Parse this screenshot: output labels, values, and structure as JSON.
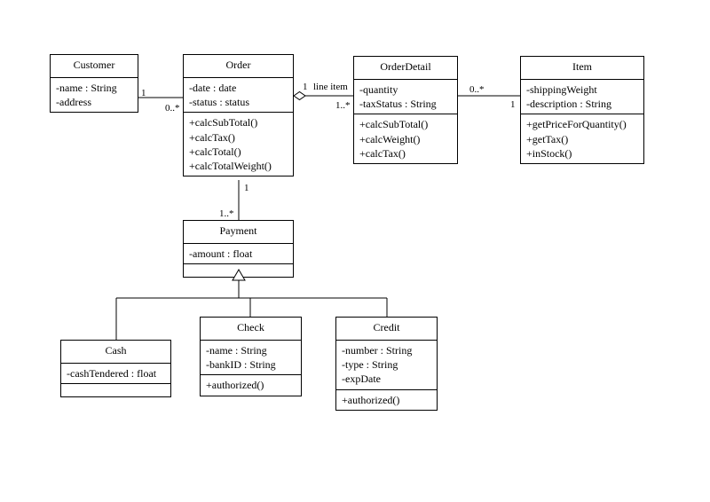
{
  "diagram": {
    "type": "UML Class Diagram",
    "classes": {
      "customer": {
        "name": "Customer",
        "attributes": [
          "-name : String",
          "-address"
        ],
        "operations": []
      },
      "order": {
        "name": "Order",
        "attributes": [
          "-date : date",
          "-status : status"
        ],
        "operations": [
          "+calcSubTotal()",
          "+calcTax()",
          "+calcTotal()",
          "+calcTotalWeight()"
        ]
      },
      "orderDetail": {
        "name": "OrderDetail",
        "attributes": [
          "-quantity",
          "-taxStatus : String"
        ],
        "operations": [
          "+calcSubTotal()",
          "+calcWeight()",
          "+calcTax()"
        ]
      },
      "item": {
        "name": "Item",
        "attributes": [
          "-shippingWeight",
          "-description : String"
        ],
        "operations": [
          "+getPriceForQuantity()",
          "+getTax()",
          "+inStock()"
        ]
      },
      "payment": {
        "name": "Payment",
        "attributes": [
          "-amount : float"
        ],
        "operations": []
      },
      "cash": {
        "name": "Cash",
        "attributes": [
          "-cashTendered : float"
        ],
        "operations": []
      },
      "check": {
        "name": "Check",
        "attributes": [
          "-name : String",
          "-bankID : String"
        ],
        "operations": [
          "+authorized()"
        ]
      },
      "credit": {
        "name": "Credit",
        "attributes": [
          "-number : String",
          "-type : String",
          "-expDate"
        ],
        "operations": [
          "+authorized()"
        ]
      }
    },
    "associations": {
      "customer_order": {
        "endA": "1",
        "endB": "0..*",
        "label": ""
      },
      "order_orderDetail": {
        "endA": "1",
        "endB": "1..*",
        "label": "line item",
        "aggregation": "diamond-on-order"
      },
      "orderDetail_item": {
        "endA": "0..*",
        "endB": "1"
      },
      "order_payment": {
        "endA": "1",
        "endB": "1..*"
      }
    },
    "generalizations": [
      "Cash → Payment",
      "Check → Payment",
      "Credit → Payment"
    ]
  },
  "chart_data": {
    "type": "table",
    "title": "UML Class Diagram — Order System",
    "classes": [
      {
        "name": "Customer",
        "attributes": [
          "-name : String",
          "-address"
        ],
        "operations": []
      },
      {
        "name": "Order",
        "attributes": [
          "-date : date",
          "-status : status"
        ],
        "operations": [
          "+calcSubTotal()",
          "+calcTax()",
          "+calcTotal()",
          "+calcTotalWeight()"
        ]
      },
      {
        "name": "OrderDetail",
        "attributes": [
          "-quantity",
          "-taxStatus : String"
        ],
        "operations": [
          "+calcSubTotal()",
          "+calcWeight()",
          "+calcTax()"
        ]
      },
      {
        "name": "Item",
        "attributes": [
          "-shippingWeight",
          "-description : String"
        ],
        "operations": [
          "+getPriceForQuantity()",
          "+getTax()",
          "+inStock()"
        ]
      },
      {
        "name": "Payment",
        "attributes": [
          "-amount : float"
        ],
        "operations": []
      },
      {
        "name": "Cash",
        "attributes": [
          "-cashTendered : float"
        ],
        "operations": []
      },
      {
        "name": "Check",
        "attributes": [
          "-name : String",
          "-bankID : String"
        ],
        "operations": [
          "+authorized()"
        ]
      },
      {
        "name": "Credit",
        "attributes": [
          "-number : String",
          "-type : String",
          "-expDate"
        ],
        "operations": [
          "+authorized()"
        ]
      }
    ],
    "relationships": [
      {
        "from": "Customer",
        "to": "Order",
        "type": "association",
        "fromMult": "1",
        "toMult": "0..*"
      },
      {
        "from": "Order",
        "to": "OrderDetail",
        "type": "aggregation",
        "fromMult": "1",
        "toMult": "1..*",
        "label": "line item"
      },
      {
        "from": "OrderDetail",
        "to": "Item",
        "type": "association",
        "fromMult": "0..*",
        "toMult": "1"
      },
      {
        "from": "Order",
        "to": "Payment",
        "type": "association",
        "fromMult": "1",
        "toMult": "1..*"
      },
      {
        "from": "Cash",
        "to": "Payment",
        "type": "generalization"
      },
      {
        "from": "Check",
        "to": "Payment",
        "type": "generalization"
      },
      {
        "from": "Credit",
        "to": "Payment",
        "type": "generalization"
      }
    ]
  }
}
